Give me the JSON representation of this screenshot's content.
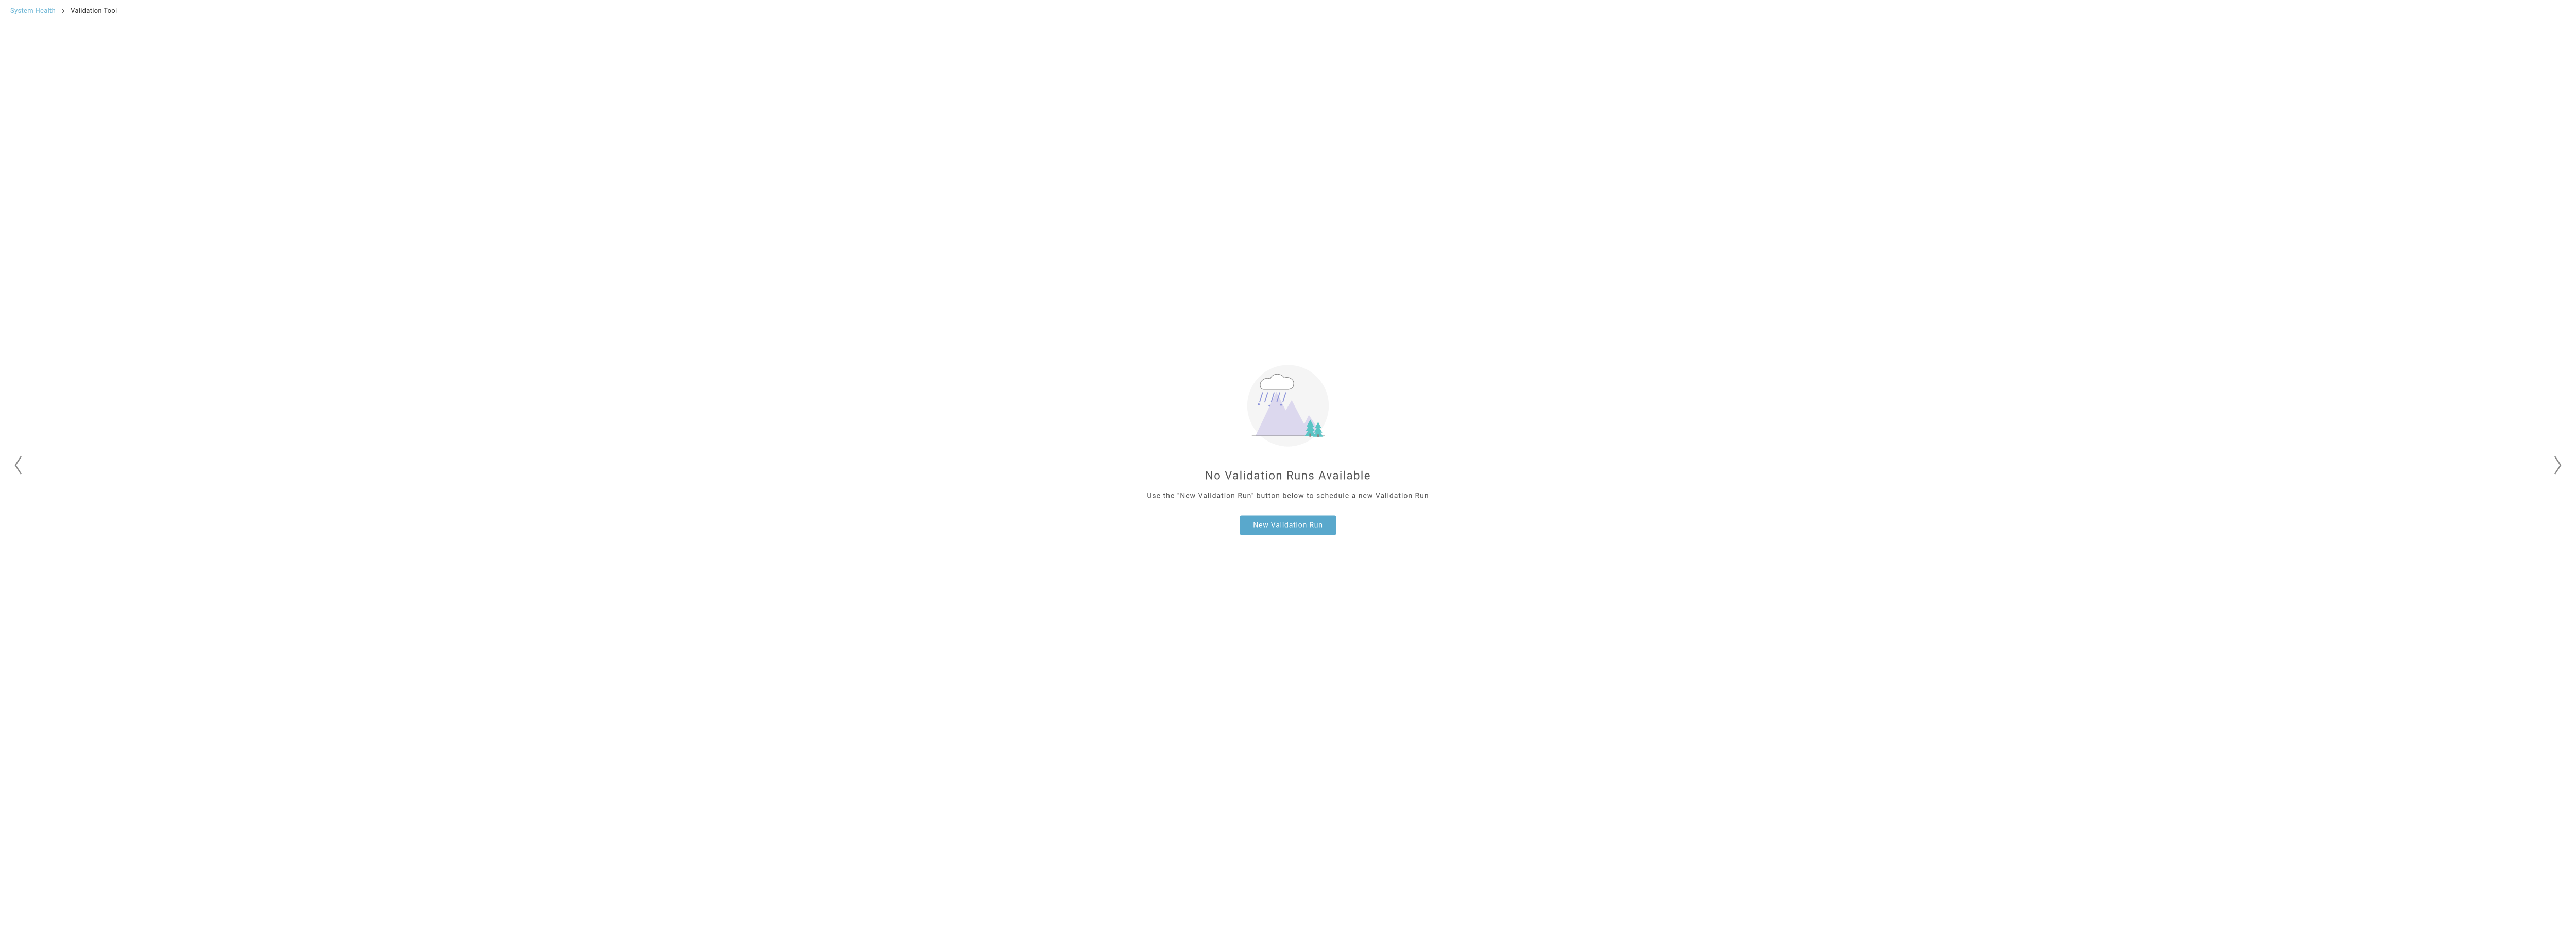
{
  "breadcrumb": {
    "parent": "System Health",
    "current": "Validation Tool"
  },
  "empty_state": {
    "title": "No Validation Runs Available",
    "subtitle": "Use the \"New Validation Run\" button below to schedule a new Validation Run",
    "button_label": "New Validation Run"
  }
}
